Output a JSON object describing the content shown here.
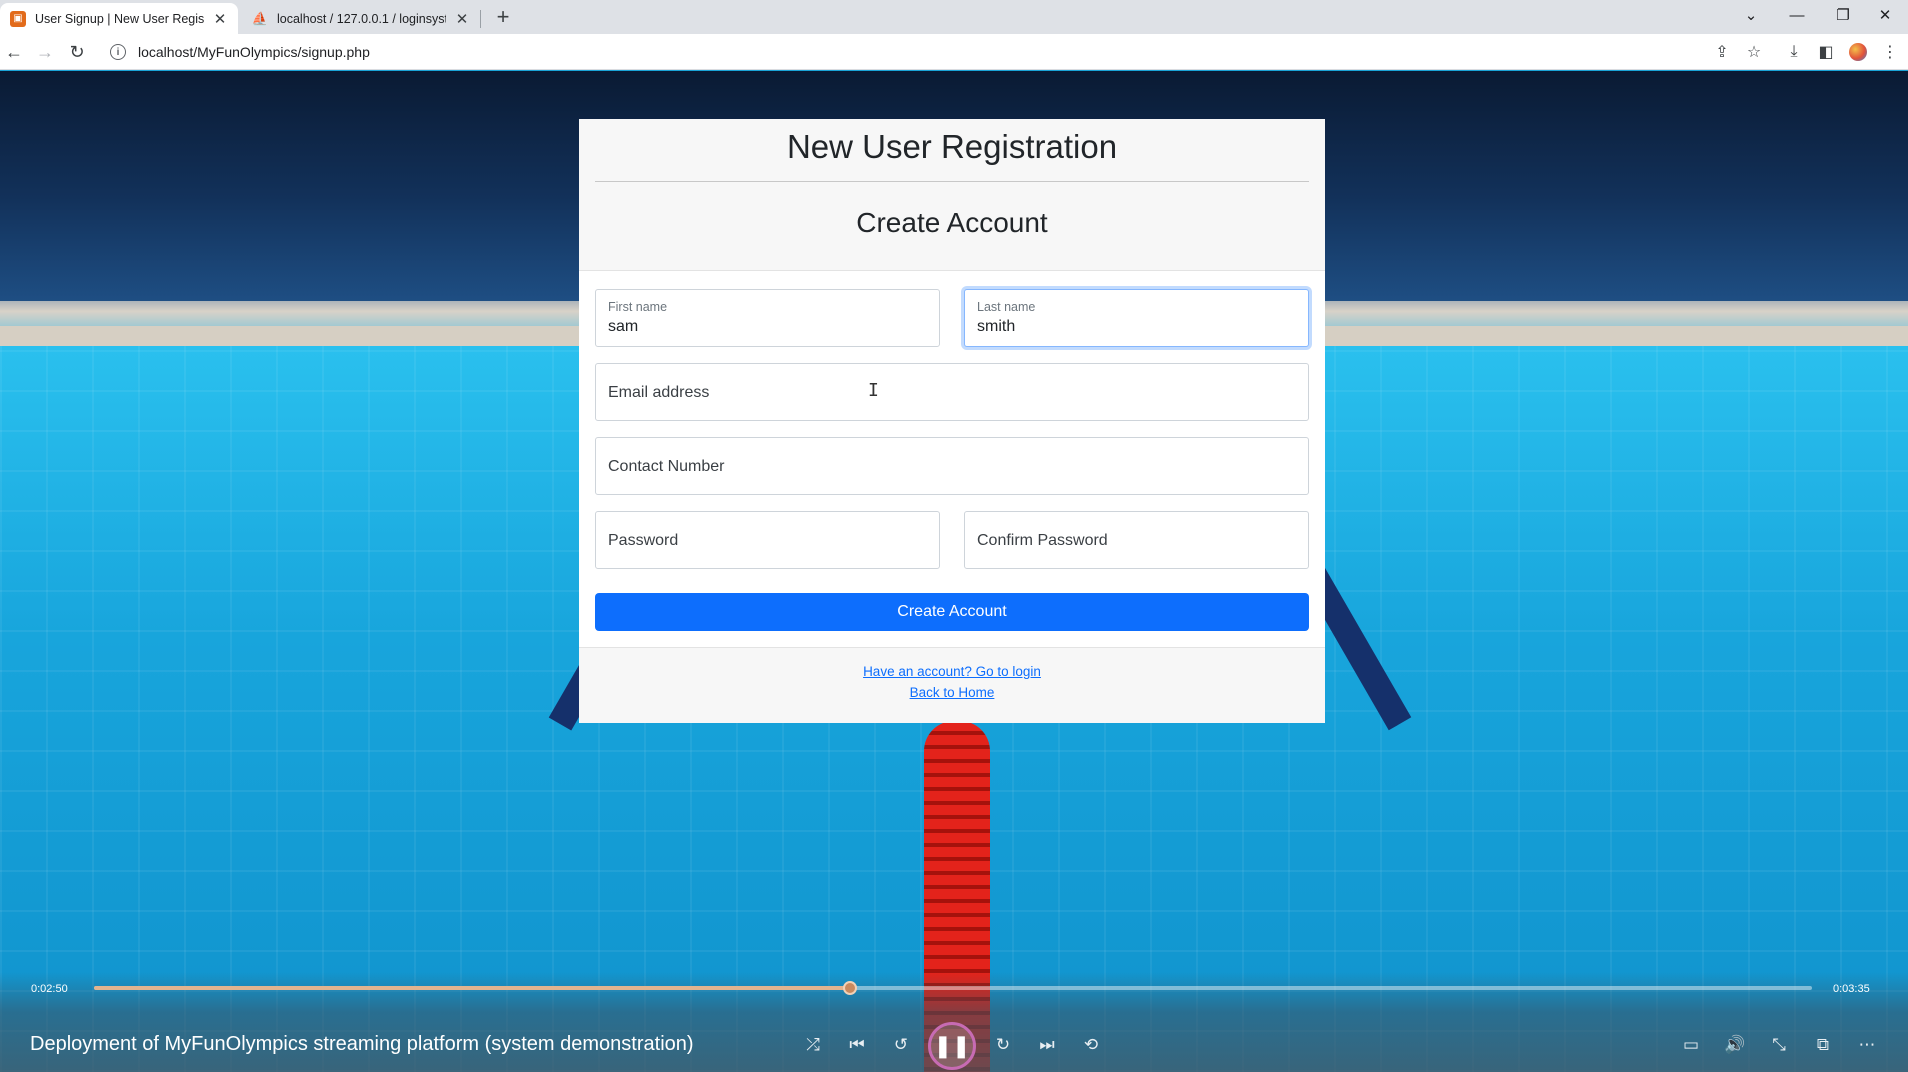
{
  "browser": {
    "tabs": [
      {
        "title": "User Signup | New User Registrat",
        "active": true,
        "favicon": "page-icon"
      },
      {
        "title": "localhost / 127.0.0.1 / loginsyster",
        "active": false,
        "favicon": "phpmyadmin-icon"
      }
    ],
    "url": "localhost/MyFunOlympics/signup.php"
  },
  "card": {
    "title": "New User Registration",
    "subtitle": "Create Account"
  },
  "form": {
    "first_name": {
      "label": "First name",
      "value": "sam"
    },
    "last_name": {
      "label": "Last name",
      "value": "smith"
    },
    "email": {
      "placeholder": "Email address"
    },
    "contact": {
      "placeholder": "Contact Number"
    },
    "password": {
      "placeholder": "Password"
    },
    "confirm_password": {
      "placeholder": "Confirm Password"
    },
    "submit_label": "Create Account"
  },
  "footer": {
    "login_link": "Have an account? Go to login",
    "home_link": "Back to Home"
  },
  "player": {
    "current_time": "0:02:50",
    "total_time": "0:03:35",
    "progress_fraction": 0.44,
    "title": "Deployment of MyFunOlympics streaming platform (system demonstration)"
  },
  "colors": {
    "primary_button": "#0d6efd",
    "link": "#0d6efd",
    "pause_ring": "#c76bb3"
  }
}
